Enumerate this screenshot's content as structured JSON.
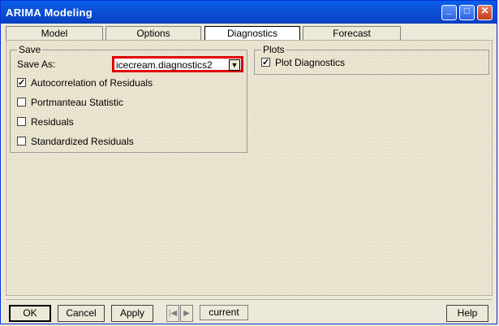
{
  "window": {
    "title": "ARIMA Modeling"
  },
  "tabs": [
    {
      "label": "Model"
    },
    {
      "label": "Options"
    },
    {
      "label": "Diagnostics",
      "active": true
    },
    {
      "label": "Forecast"
    }
  ],
  "save_group": {
    "legend": "Save",
    "save_as_label": "Save As:",
    "save_as_value": "icecream.diagnostics2",
    "options": [
      {
        "label": "Autocorrelation of Residuals",
        "checked": true
      },
      {
        "label": "Portmanteau Statistic",
        "checked": false
      },
      {
        "label": "Residuals",
        "checked": false
      },
      {
        "label": "Standardized Residuals",
        "checked": false
      }
    ]
  },
  "plots_group": {
    "legend": "Plots",
    "options": [
      {
        "label": "Plot Diagnostics",
        "checked": true
      }
    ]
  },
  "footer": {
    "ok": "OK",
    "cancel": "Cancel",
    "apply": "Apply",
    "current": "current",
    "help": "Help"
  },
  "colors": {
    "titlebar": "#0a5ee8",
    "highlight": "#e00000"
  },
  "icons": {
    "minimize": "minimize-icon",
    "maximize": "maximize-icon",
    "close": "close-icon"
  }
}
